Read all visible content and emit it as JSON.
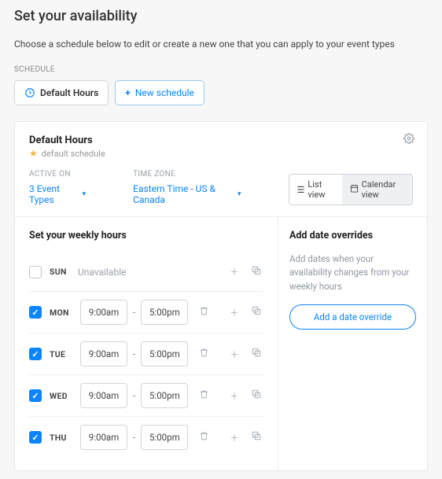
{
  "page": {
    "title": "Set your availability",
    "subtitle": "Choose a schedule below to edit or create a new one that you can apply to your event types"
  },
  "schedule_section_label": "SCHEDULE",
  "tabs": {
    "default": "Default Hours",
    "new": "New schedule"
  },
  "card": {
    "title": "Default Hours",
    "default_badge": "default schedule",
    "active_on_label": "ACTIVE ON",
    "active_on_value": "3 Event Types",
    "timezone_label": "TIME ZONE",
    "timezone_value": "Eastern Time - US & Canada",
    "list_view": "List view",
    "calendar_view": "Calendar view"
  },
  "weekly": {
    "heading": "Set your weekly hours",
    "unavailable": "Unavailable",
    "days": [
      {
        "name": "SUN",
        "checked": false
      },
      {
        "name": "MON",
        "checked": true,
        "from": "9:00am",
        "to": "5:00pm"
      },
      {
        "name": "TUE",
        "checked": true,
        "from": "9:00am",
        "to": "5:00pm"
      },
      {
        "name": "WED",
        "checked": true,
        "from": "9:00am",
        "to": "5:00pm"
      },
      {
        "name": "THU",
        "checked": true,
        "from": "9:00am",
        "to": "5:00pm"
      }
    ]
  },
  "overrides": {
    "heading": "Add date overrides",
    "desc": "Add dates when your availability changes from your weekly hours",
    "button": "Add a date override"
  }
}
